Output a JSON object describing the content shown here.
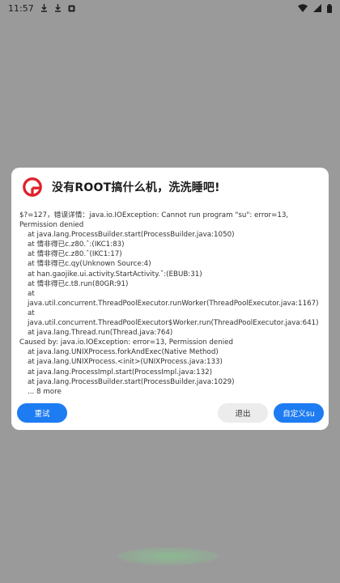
{
  "status_bar": {
    "time": "11:57",
    "left_icons": [
      "download-icon",
      "download-icon",
      "app-notification-icon"
    ],
    "right_icons": [
      "wifi-icon",
      "cellular-signal-icon",
      "battery-icon"
    ]
  },
  "dialog": {
    "logo_icon": "root-tool-logo-icon",
    "title": "没有ROOT搞什么机，洗洗睡吧!",
    "error_lines": [
      {
        "text": "$?=127，错误详情：java.io.IOException: Cannot run program \"su\": error=13, Permission denied",
        "indent": false
      },
      {
        "text": "at java.lang.ProcessBuilder.start(ProcessBuilder.java:1050)",
        "indent": true
      },
      {
        "text": "at 情非得已c.z80.ˆ:(IKC1:83)",
        "indent": true
      },
      {
        "text": "at 情非得已c.z80.ˆ(IKC1:17)",
        "indent": true
      },
      {
        "text": "at 情非得已c.qy(Unknown Source:4)",
        "indent": true
      },
      {
        "text": "at han.gaojike.ui.activity.StartActivity.ˆ:(EBUB:31)",
        "indent": true
      },
      {
        "text": "at 情非得已c.t8.run(80GR:91)",
        "indent": true
      },
      {
        "text": "at java.util.concurrent.ThreadPoolExecutor.runWorker(ThreadPoolExecutor.java:1167)",
        "indent": true
      },
      {
        "text": "at java.util.concurrent.ThreadPoolExecutor$Worker.run(ThreadPoolExecutor.java:641)",
        "indent": true
      },
      {
        "text": "at java.lang.Thread.run(Thread.java:764)",
        "indent": true
      },
      {
        "text": "Caused by: java.io.IOException: error=13, Permission denied",
        "indent": false
      },
      {
        "text": "at java.lang.UNIXProcess.forkAndExec(Native Method)",
        "indent": true
      },
      {
        "text": "at java.lang.UNIXProcess.<init>(UNIXProcess.java:133)",
        "indent": true
      },
      {
        "text": "at java.lang.ProcessImpl.start(ProcessImpl.java:132)",
        "indent": true
      },
      {
        "text": "at java.lang.ProcessBuilder.start(ProcessBuilder.java:1029)",
        "indent": true
      },
      {
        "text": "... 8 more",
        "indent": true
      }
    ],
    "buttons": {
      "retry": "重试",
      "exit": "退出",
      "custom_su": "自定义su"
    }
  },
  "colors": {
    "accent": "#1e7cf2",
    "overlay": "#9a9a9a",
    "dialog_bg": "#ffffff",
    "logo_red": "#e0202a"
  }
}
